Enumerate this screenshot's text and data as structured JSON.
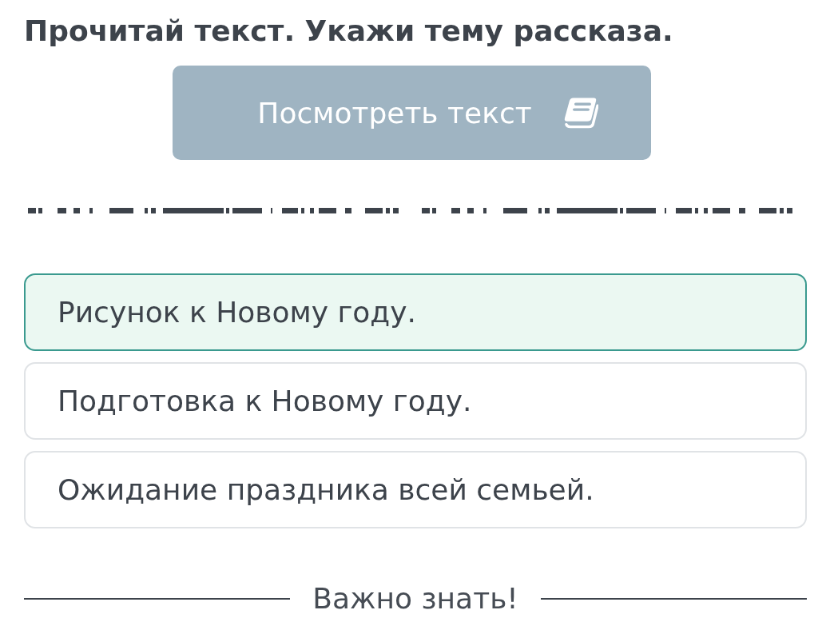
{
  "heading": "Прочитай текст. Укажи тему рассказа.",
  "view_text_button": {
    "label": "Посмотреть текст"
  },
  "options": [
    {
      "text": "Рисунок к Новому году.",
      "selected": true
    },
    {
      "text": "Подготовка к Новому году.",
      "selected": false
    },
    {
      "text": "Ожидание праздника всей семьей.",
      "selected": false
    }
  ],
  "section_divider": {
    "label": "Важно знать!"
  }
}
